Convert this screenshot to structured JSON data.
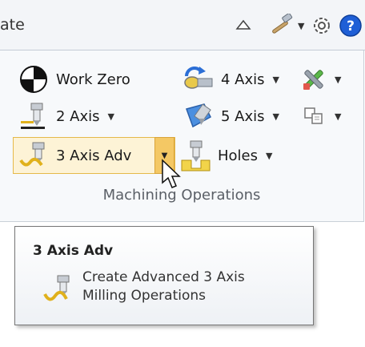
{
  "header": {
    "tab_text": "ate",
    "icons": [
      "chevron-up-icon",
      "hammer-icon",
      "gear-icon",
      "help-icon"
    ]
  },
  "ribbon": {
    "work_zero": {
      "label": "Work Zero",
      "icon": "work-zero-icon"
    },
    "four_axis": {
      "label": "4 Axis",
      "icon": "four-axis-icon"
    },
    "two_axis": {
      "label": "2 Axis",
      "icon": "two-axis-icon"
    },
    "five_axis": {
      "label": "5 Axis",
      "icon": "five-axis-icon"
    },
    "three_axis_adv": {
      "label": "3 Axis Adv",
      "icon": "three-axis-adv-icon",
      "state": "hover"
    },
    "holes": {
      "label": "Holes",
      "icon": "holes-icon"
    },
    "tools_icon": "tools-icon",
    "copy_icon": "copy-icon",
    "group_label": "Machining Operations"
  },
  "tooltip": {
    "title": "3 Axis Adv",
    "description": "Create Advanced 3 Axis\nMilling Operations"
  },
  "colors": {
    "hover_fill": "#fdf3d6",
    "hover_border": "#e5b94a",
    "split_fill": "#f4c864",
    "help_blue": "#1f5fd6"
  }
}
